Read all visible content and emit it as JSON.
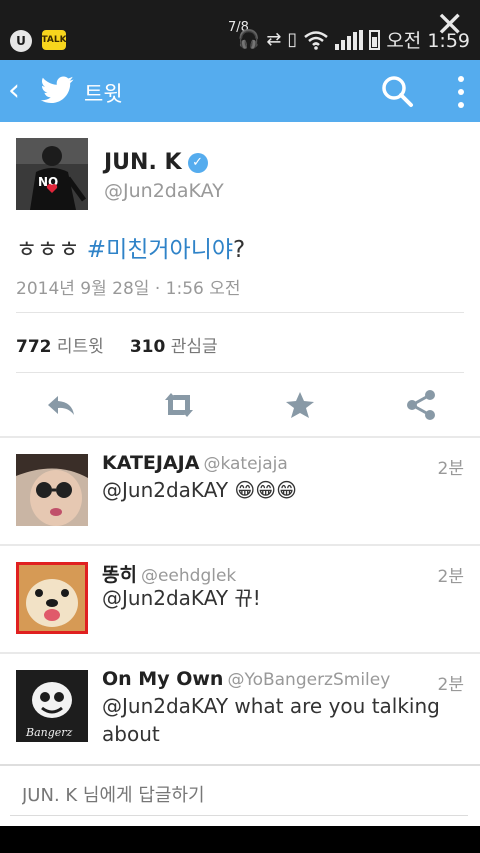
{
  "status_bar": {
    "time": "오전 1:59",
    "page_indicator": "7/8",
    "icons": [
      "u-plus-icon",
      "kakaotalk-icon",
      "headset-icon",
      "sync-icon",
      "vibrate-icon",
      "wifi-icon",
      "signal-icon",
      "battery-icon",
      "close-icon"
    ],
    "talk_badge": "TALK"
  },
  "action_bar": {
    "title": "트윗",
    "color": "#55acee"
  },
  "tweet": {
    "author_name": "JUN. K",
    "handle": "@Jun2daKAY",
    "text_prefix": "ㅎㅎㅎ ",
    "hashtag": "#미친거아니야",
    "text_suffix": "?",
    "timestamp": "2014년 9월 28일 · 1:56 오전",
    "avatar_caption": "NO",
    "retweet_count": "772",
    "retweet_label": "리트윗",
    "favorite_count": "310",
    "favorite_label": "관심글"
  },
  "replies": [
    {
      "name": "KATEJAJA",
      "handle": "@katejaja",
      "time": "2분",
      "text": "@Jun2daKAY 😁😁😁"
    },
    {
      "name": "똥히",
      "handle": "@eehdglek",
      "time": "2분",
      "text": "@Jun2daKAY 뀨!"
    },
    {
      "name": "On My Own",
      "handle": "@YoBangerzSmiley",
      "time": "2분",
      "text": "@Jun2daKAY what are you talking about",
      "avatar_caption": "Bangerz"
    }
  ],
  "compose": {
    "placeholder": "JUN. K 님에게 답글하기"
  }
}
